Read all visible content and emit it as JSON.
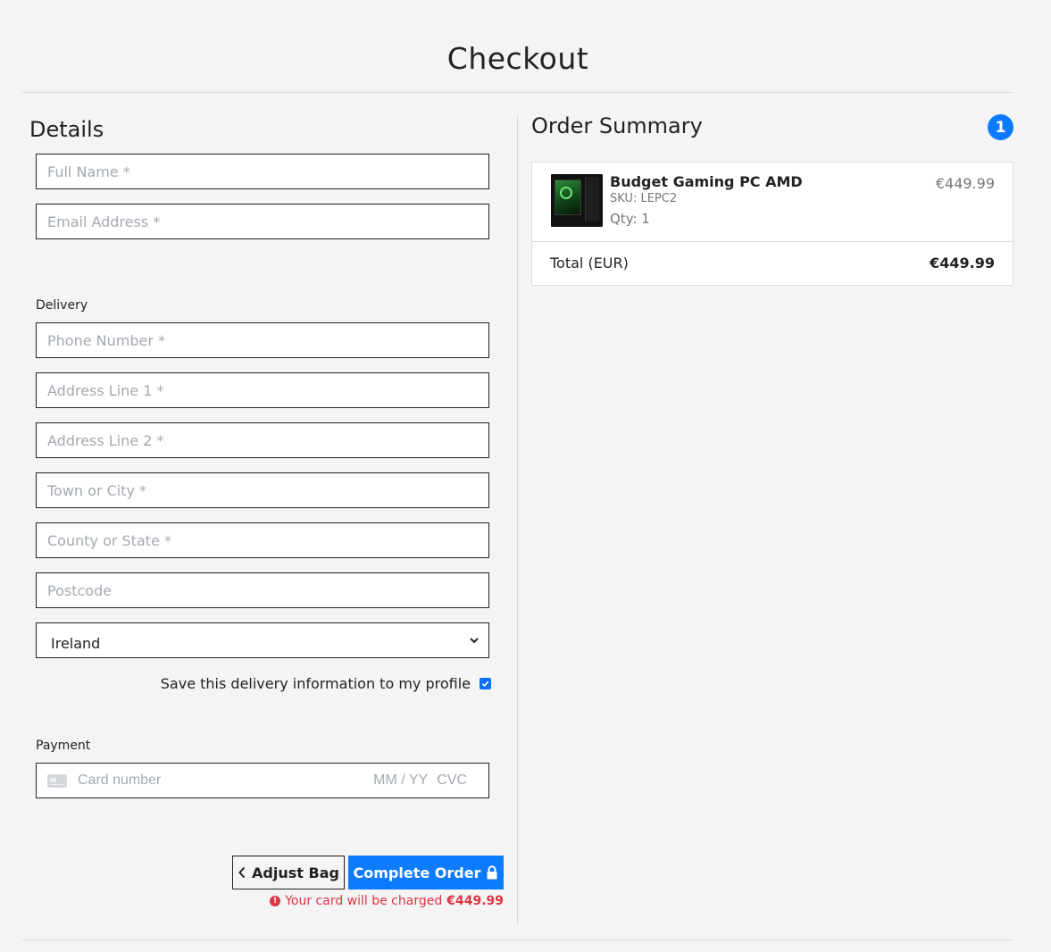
{
  "page": {
    "title": "Checkout"
  },
  "details": {
    "heading": "Details",
    "full_name_placeholder": "Full Name *",
    "email_placeholder": "Email Address *"
  },
  "delivery": {
    "label": "Delivery",
    "phone_placeholder": "Phone Number *",
    "address1_placeholder": "Address Line 1 *",
    "address2_placeholder": "Address Line 2 *",
    "town_placeholder": "Town or City *",
    "county_placeholder": "County or State *",
    "postcode_placeholder": "Postcode",
    "country_selected": "Ireland",
    "save_label": "Save this delivery information to my profile",
    "save_checked": true
  },
  "payment": {
    "label": "Payment",
    "card_placeholder": "Card number",
    "expiry_placeholder": "MM / YY",
    "cvc_placeholder": "CVC"
  },
  "actions": {
    "adjust_label": "Adjust Bag",
    "complete_label": "Complete Order",
    "charge_note": "Your card will be charged",
    "charge_amount": "€449.99"
  },
  "summary": {
    "heading": "Order Summary",
    "item_count": "1",
    "items": [
      {
        "name": "Budget Gaming PC AMD",
        "sku": "SKU: LEPC2",
        "qty": "Qty: 1",
        "price": "€449.99"
      }
    ],
    "total_label": "Total (EUR)",
    "total_value": "€449.99"
  },
  "colors": {
    "accent": "#0d7bff",
    "error": "#dc3545",
    "background": "#f4f4f4"
  },
  "icons": {
    "adjust_button": "chevron-left-icon",
    "complete_button": "lock-icon",
    "charge_note": "exclamation-circle-icon",
    "country_select": "chevron-down-icon",
    "card_field": "credit-card-icon"
  }
}
